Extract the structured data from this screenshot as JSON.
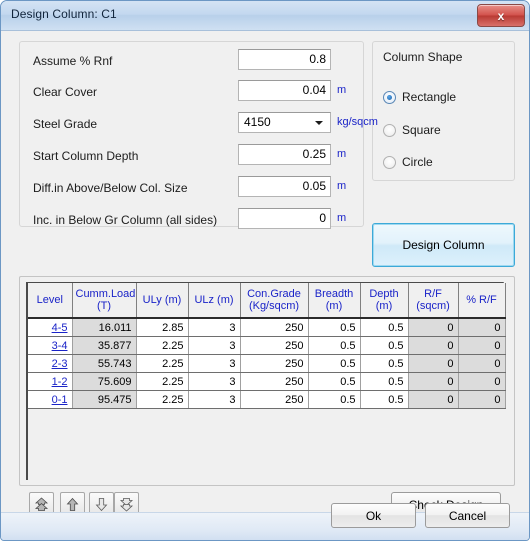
{
  "window": {
    "title": "Design Column: C1",
    "close_icon": "close-icon",
    "close_label": "x"
  },
  "parameters": {
    "group_label": "",
    "fields": [
      {
        "label": "Assume % Rnf",
        "value": "0.8",
        "unit": ""
      },
      {
        "label": "Clear Cover",
        "value": "0.04",
        "unit": "m"
      },
      {
        "label": "Steel Grade",
        "value": "4150",
        "unit": "kg/sqcm"
      },
      {
        "label": "Start Column Depth",
        "value": "0.25",
        "unit": "m"
      },
      {
        "label": "Diff.in Above/Below Col. Size",
        "value": "0.05",
        "unit": "m"
      },
      {
        "label": "Inc. in Below Gr Column (all sides)",
        "value": "0",
        "unit": "m"
      }
    ]
  },
  "column_shape": {
    "title": "Column Shape",
    "options": [
      {
        "label": "Rectangle",
        "selected": true
      },
      {
        "label": "Square",
        "selected": false
      },
      {
        "label": "Circle",
        "selected": false
      }
    ]
  },
  "buttons": {
    "design_column": "Design Column",
    "check_design": "Check Design",
    "ok": "Ok",
    "cancel": "Cancel"
  },
  "nav_buttons": [
    {
      "name": "first-record-button",
      "icon": "double-up-arrow-icon"
    },
    {
      "name": "previous-record-button",
      "icon": "up-arrow-icon"
    },
    {
      "name": "next-record-button",
      "icon": "down-arrow-icon"
    },
    {
      "name": "last-record-button",
      "icon": "double-down-arrow-icon"
    }
  ],
  "table": {
    "columns": [
      "Level",
      "Cumm.Load (T)",
      "ULy (m)",
      "ULz (m)",
      "Con.Grade (Kg/sqcm)",
      "Breadth (m)",
      "Depth (m)",
      "R/F (sqcm)",
      "% R/F"
    ],
    "columns_lines": [
      [
        "Level",
        ""
      ],
      [
        "Cumm.Load",
        "(T)"
      ],
      [
        "ULy (m)",
        ""
      ],
      [
        "ULz (m)",
        ""
      ],
      [
        "Con.Grade",
        "(Kg/sqcm)"
      ],
      [
        "Breadth",
        "(m)"
      ],
      [
        "Depth",
        "(m)"
      ],
      [
        "R/F",
        "(sqcm)"
      ],
      [
        "% R/F",
        ""
      ]
    ],
    "rows": [
      {
        "level": "4-5",
        "cumm_load": "16.011",
        "uly": "2.85",
        "ulz": "3",
        "con_grade": "250",
        "breadth": "0.5",
        "depth": "0.5",
        "rf": "0",
        "pct_rf": "0"
      },
      {
        "level": "3-4",
        "cumm_load": "35.877",
        "uly": "2.25",
        "ulz": "3",
        "con_grade": "250",
        "breadth": "0.5",
        "depth": "0.5",
        "rf": "0",
        "pct_rf": "0"
      },
      {
        "level": "2-3",
        "cumm_load": "55.743",
        "uly": "2.25",
        "ulz": "3",
        "con_grade": "250",
        "breadth": "0.5",
        "depth": "0.5",
        "rf": "0",
        "pct_rf": "0"
      },
      {
        "level": "1-2",
        "cumm_load": "75.609",
        "uly": "2.25",
        "ulz": "3",
        "con_grade": "250",
        "breadth": "0.5",
        "depth": "0.5",
        "rf": "0",
        "pct_rf": "0"
      },
      {
        "level": "0-1",
        "cumm_load": "95.475",
        "uly": "2.25",
        "ulz": "3",
        "con_grade": "250",
        "breadth": "0.5",
        "depth": "0.5",
        "rf": "0",
        "pct_rf": "0"
      }
    ]
  },
  "colors": {
    "accent_blue": "#1a23c8",
    "title_bg": "#c3d8ef",
    "close_red": "#c0392b",
    "readonly_cell": "#dcdcdc"
  }
}
